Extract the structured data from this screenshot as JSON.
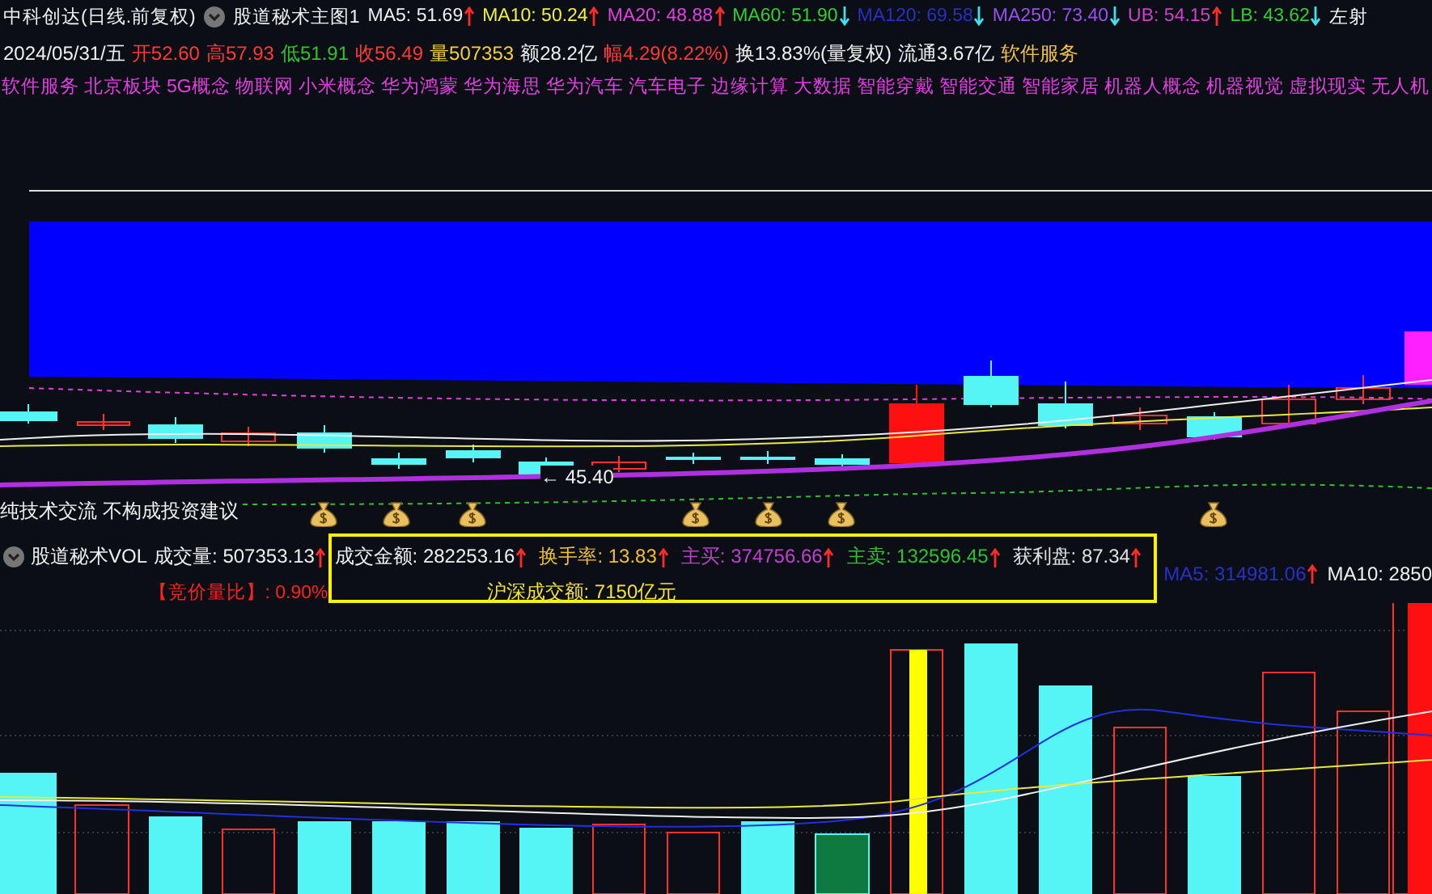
{
  "header": {
    "title": "中科创达(日线.前复权)",
    "indicator_name": "股道秘术主图1",
    "cut_text": "左射",
    "indicators": [
      {
        "label": "MA5:",
        "value": "51.69",
        "color": "#f0f0f0",
        "rising": true
      },
      {
        "label": "MA10:",
        "value": "50.24",
        "color": "#f0f040",
        "rising": true
      },
      {
        "label": "MA20:",
        "value": "48.88",
        "color": "#e040e0",
        "rising": true
      },
      {
        "label": "MA60:",
        "value": "51.90",
        "color": "#30d030",
        "rising": false
      },
      {
        "label": "MA120:",
        "value": "69.58",
        "color": "#2830c8",
        "rising": false
      },
      {
        "label": "MA250:",
        "value": "73.40",
        "color": "#9a50f0",
        "rising": false
      },
      {
        "label": "UB:",
        "value": "54.15",
        "color": "#d040d0",
        "rising": true
      },
      {
        "label": "LB:",
        "value": "43.62",
        "color": "#30d030",
        "rising": false
      }
    ]
  },
  "quote": {
    "date": "2024/05/31/五",
    "items": [
      {
        "label": "开",
        "value": "52.60",
        "color": "#ff3838"
      },
      {
        "label": "高",
        "value": "57.93",
        "color": "#ff3838"
      },
      {
        "label": "低",
        "value": "51.91",
        "color": "#30c030"
      },
      {
        "label": "收",
        "value": "56.49",
        "color": "#ff3838"
      },
      {
        "label": "量",
        "value": "507353",
        "color": "#f0d040"
      },
      {
        "label": "额",
        "value": "28.2亿",
        "color": "#f0f0f0"
      },
      {
        "label": "幅",
        "value": "4.29(8.22%)",
        "color": "#ff3838"
      },
      {
        "label": "换",
        "value": "13.83%(量复权)",
        "color": "#f0f0f0"
      },
      {
        "label": "流通",
        "value": "3.67亿",
        "color": "#f0f0f0"
      },
      {
        "value": "软件服务",
        "color": "#f0c050"
      }
    ]
  },
  "concepts": [
    "软件服务",
    "北京板块",
    "5G概念",
    "物联网",
    "小米概念",
    "华为鸿蒙",
    "华为海思",
    "华为汽车",
    "汽车电子",
    "边缘计算",
    "大数据",
    "智能穿戴",
    "智能交通",
    "智能家居",
    "机器人概念",
    "机器视觉",
    "虚拟现实",
    "无人机"
  ],
  "chart": {
    "price_label": "← 45.40",
    "disclaimer": "纯技术交流 不构成投资建议"
  },
  "volume": {
    "name": "股道秘术VOL",
    "left_items": [
      {
        "label": "成交量:",
        "value": "507353.13",
        "color": "#f0f0f0",
        "rising": true
      }
    ],
    "auction": "【竞价量比】: 0.90%",
    "boxed_items": [
      {
        "label": "成交金额:",
        "value": "282253.16",
        "color": "#f0f0f0",
        "rising": true
      },
      {
        "label": "换手率:",
        "value": "13.83",
        "color": "#f0c030",
        "rising": true
      },
      {
        "label": "主买:",
        "value": "374756.66",
        "color": "#c040d0",
        "rising": true
      },
      {
        "label": "主卖:",
        "value": "132596.45",
        "color": "#30c030",
        "rising": true
      },
      {
        "label": "获利盘:",
        "value": "87.34",
        "color": "#e0e0e0",
        "rising": true
      }
    ],
    "market_turnover": "沪深成交额: 7150亿元",
    "right_items": [
      {
        "label": "MA5:",
        "value": "314981.06",
        "color": "#2830c8",
        "rising": true
      },
      {
        "label": "MA10:",
        "value": "2850",
        "color": "#f0f0f0"
      }
    ]
  }
}
